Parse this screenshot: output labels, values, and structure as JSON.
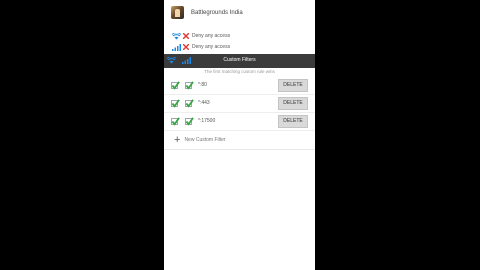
{
  "app": {
    "name": "Battlegrounds India"
  },
  "permissions": [
    {
      "icon": "wifi-icon",
      "text": "Deny any access"
    },
    {
      "icon": "signal-icon",
      "text": "Deny any access"
    }
  ],
  "dialog": {
    "title": "Custom Filters",
    "subtitle": "The first matching custom rule wins",
    "filters": [
      {
        "rule": "*:80",
        "wifi_checked": true,
        "data_checked": true,
        "delete_label": "DELETE"
      },
      {
        "rule": "*:443",
        "wifi_checked": true,
        "data_checked": true,
        "delete_label": "DELETE"
      },
      {
        "rule": "*:17500",
        "wifi_checked": true,
        "data_checked": true,
        "delete_label": "DELETE"
      }
    ],
    "new_filter_label": "New Custom Filter"
  },
  "colors": {
    "accent": "#1e88e5",
    "check": "#3aa345",
    "deny": "#e53935",
    "header": "#3b3b3b"
  }
}
